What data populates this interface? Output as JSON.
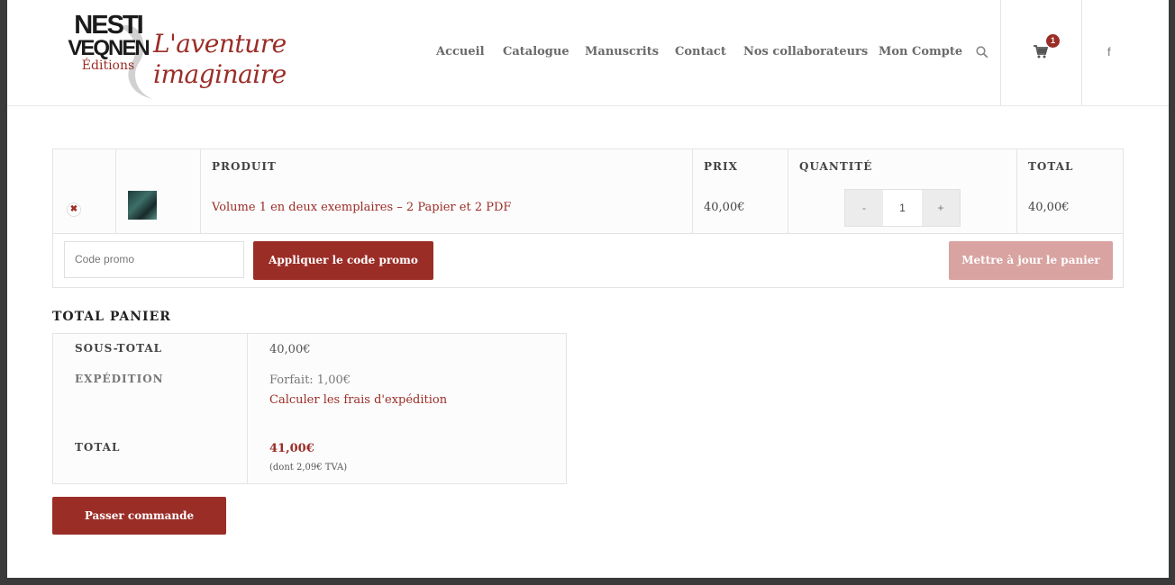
{
  "header": {
    "logo": {
      "line1": "NESTI",
      "line2": "VEQNEN",
      "line3": "Éditions",
      "tagline1": "L'aventure",
      "tagline2": "imaginaire"
    },
    "nav": [
      "Accueil",
      "Catalogue",
      "Manuscrits",
      "Contact",
      "Nos collaborateurs",
      "Mon Compte"
    ],
    "cart_count": "1",
    "icons": [
      "search-icon",
      "cart-icon",
      "facebook-icon"
    ],
    "facebook": "f"
  },
  "cart": {
    "headers": {
      "product": "PRODUIT",
      "price": "PRIX",
      "quantity": "QUANTITÉ",
      "total": "TOTAL"
    },
    "item": {
      "remove": "✖",
      "name": "Volume 1 en deux exemplaires – 2 Papier et 2 PDF",
      "price": "40,00€",
      "qty_minus": "-",
      "qty": "1",
      "qty_plus": "+",
      "total": "40,00€"
    },
    "coupon_placeholder": "Code promo",
    "apply_label": "Appliquer le code promo",
    "update_label": "Mettre à jour le panier"
  },
  "totals": {
    "title": "TOTAL PANIER",
    "subtotal_label": "SOUS-TOTAL",
    "subtotal": "40,00€",
    "shipping_label": "EXPÉDITION",
    "shipping_value": "Forfait: 1,00€",
    "shipping_link": "Calculer les frais d'expédition",
    "total_label": "TOTAL",
    "total": "41,00€",
    "tax": "(dont 2,09€ TVA)"
  },
  "checkout_label": "Passer commande",
  "colors": {
    "accent": "#9b2d27",
    "accent_light": "#d8a3a1",
    "border": "#e4e4e4"
  }
}
